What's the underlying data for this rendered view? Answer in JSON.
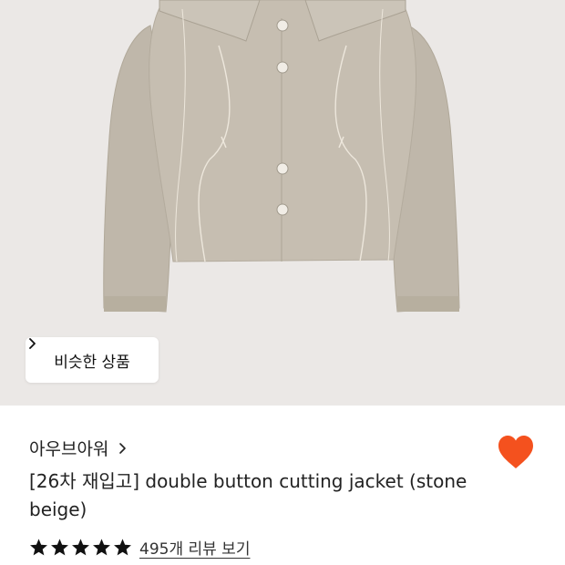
{
  "product": {
    "similar_label": "비슷한 상품",
    "brand": "아우브아워",
    "title": "[26차 재입고] double button cutting jacket (stone beige)",
    "rating": {
      "stars": 5,
      "max": 5
    },
    "reviews_label": "495개 리뷰 보기",
    "liked": true
  },
  "colors": {
    "hero_bg": "#ebe8e6",
    "jacket": "#c4bcaf",
    "heart": "#f4511e",
    "star": "#111111"
  },
  "icons": {
    "similar": "chevron-right-icon",
    "brand": "chevron-right-icon",
    "wishlist": "heart-icon",
    "rating": "star-icon"
  }
}
